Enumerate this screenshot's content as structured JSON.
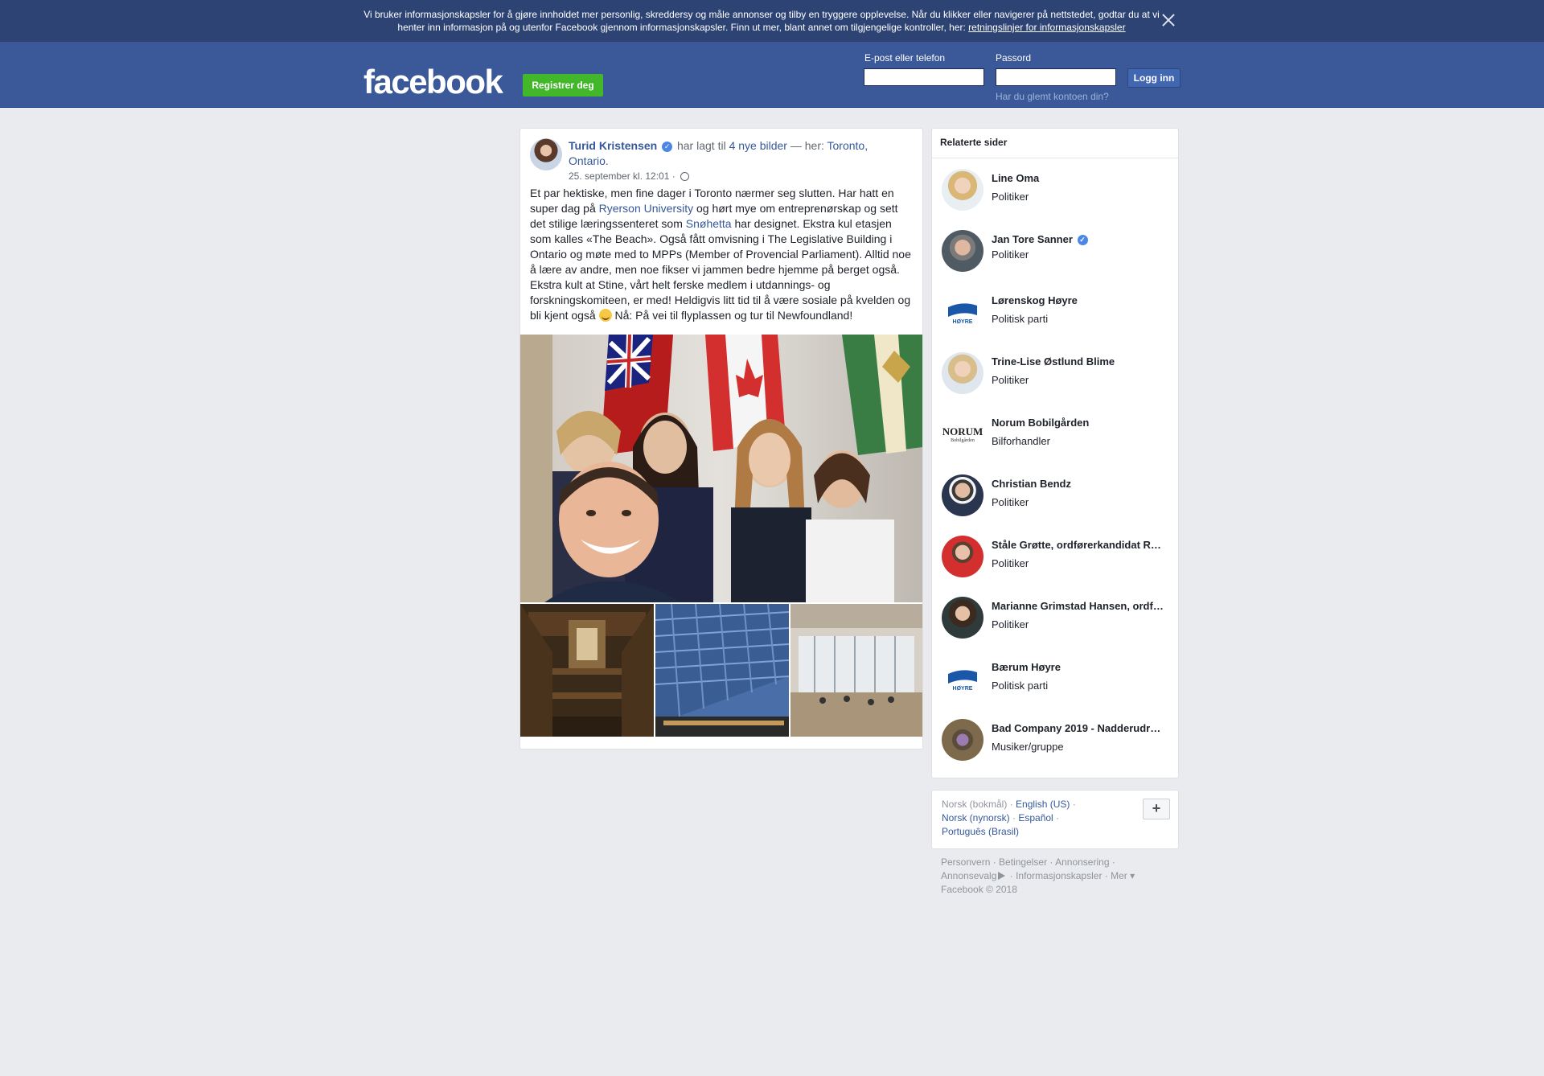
{
  "cookie_banner": {
    "text": "Vi bruker informasjonskapsler for å gjøre innholdet mer personlig, skreddersy og måle annonser og tilby en tryggere opplevelse. Når du klikker eller navigerer på nettstedet, godtar du at vi henter inn informasjon på og utenfor Facebook gjennom informasjonskapsler. Finn ut mer, blant annet om tilgjengelige kontroller, her: ",
    "link": "retningslinjer for informasjonskapsler"
  },
  "header": {
    "logo": "facebook",
    "register_label": "Registrer deg",
    "email_label": "E-post eller telefon",
    "password_label": "Passord",
    "login_label": "Logg inn",
    "forgot_label": "Har du glemt kontoen din?"
  },
  "post": {
    "author": "Turid Kristensen",
    "action_text": " har lagt til ",
    "photos_link": "4 nye bilder",
    "location_sep": " — her: ",
    "location": "Toronto, Ontario",
    "location_end": ".",
    "timestamp": "25. september kl. 12:01 ·",
    "body_1": "Et par hektiske, men fine dager i Toronto nærmer seg slutten. Har hatt en super dag på ",
    "link_1": "Ryerson University",
    "body_2": " og hørt mye om entreprenørskap og sett det stilige læringssenteret som ",
    "link_2": "Snøhetta",
    "body_3": " har designet. Ekstra kul etasjen som kalles «The Beach». Også fått omvisning i The Legislative Building i Ontario og møte med to MPPs (Member of Provencial Parliament). Alltid noe å lære av andre, men noe fikser vi jammen bedre hjemme på berget også. Ekstra kult at Stine, vårt helt ferske medlem i utdannings- og forskningskomiteen, er med! Heldigvis litt tid til å være sosiale på kvelden og bli kjent også ",
    "body_4": " Nå: På vei til flyplassen og tur til Newfoundland!"
  },
  "related": {
    "title": "Relaterte sider",
    "items": [
      {
        "name": "Line Oma",
        "category": "Politiker",
        "verified": false
      },
      {
        "name": "Jan Tore Sanner",
        "category": "Politiker",
        "verified": true
      },
      {
        "name": "Lørenskog Høyre",
        "category": "Politisk parti",
        "verified": false
      },
      {
        "name": "Trine-Lise Østlund Blime",
        "category": "Politiker",
        "verified": false
      },
      {
        "name": "Norum Bobilgården",
        "category": "Bilforhandler",
        "verified": false
      },
      {
        "name": "Christian Bendz",
        "category": "Politiker",
        "verified": false
      },
      {
        "name": "Ståle Grøtte, ordførerkandidat R…",
        "category": "Politiker",
        "verified": false
      },
      {
        "name": "Marianne Grimstad Hansen, ordf…",
        "category": "Politiker",
        "verified": false
      },
      {
        "name": "Bærum Høyre",
        "category": "Politisk parti",
        "verified": false
      },
      {
        "name": "Bad Company 2019 - Nadderudr…",
        "category": "Musiker/gruppe",
        "verified": false
      }
    ],
    "logo_text_hoyre": "HØYRE",
    "logo_text_norum": "NORUM",
    "logo_text_norum_sub": "Bobilgården"
  },
  "languages": {
    "current": "Norsk (bokmål)",
    "sep": " · ",
    "english": "English (US)",
    "nynorsk": "Norsk (nynorsk)",
    "espanol": "Español",
    "portugues": "Português (Brasil)",
    "plus": "+"
  },
  "footer": {
    "personvern": "Personvern",
    "betingelser": "Betingelser",
    "annonsering": "Annonsering",
    "annonsevalg": "Annonsevalg",
    "informasjonskapsler": "Informasjonskapsler",
    "mer": "Mer",
    "copyright": "Facebook © 2018"
  },
  "colors": {
    "brand_blue": "#3b5998",
    "link_blue": "#365899",
    "register_green": "#42b72a",
    "verified_blue": "#4c87e8"
  }
}
